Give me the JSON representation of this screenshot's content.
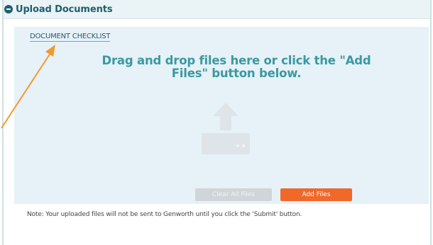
{
  "panel": {
    "title": "Upload Documents",
    "header_icon": "minus-circle-icon"
  },
  "dropzone": {
    "checklist_link": "DOCUMENT CHECKLIST",
    "drop_text": "Drag and drop files here or click the \"Add Files\" button below.",
    "upload_icon": "upload-tray-icon",
    "clear_button": "Clear All Files",
    "add_button": "Add Files"
  },
  "note": "Note: Your uploaded files will not be sent to Genworth until you click the 'Submit' button.",
  "colors": {
    "header_text": "#1e5f6f",
    "drop_text": "#3a9aa0",
    "add_button": "#f0692a",
    "annotation_arrow": "#f39a2b"
  }
}
